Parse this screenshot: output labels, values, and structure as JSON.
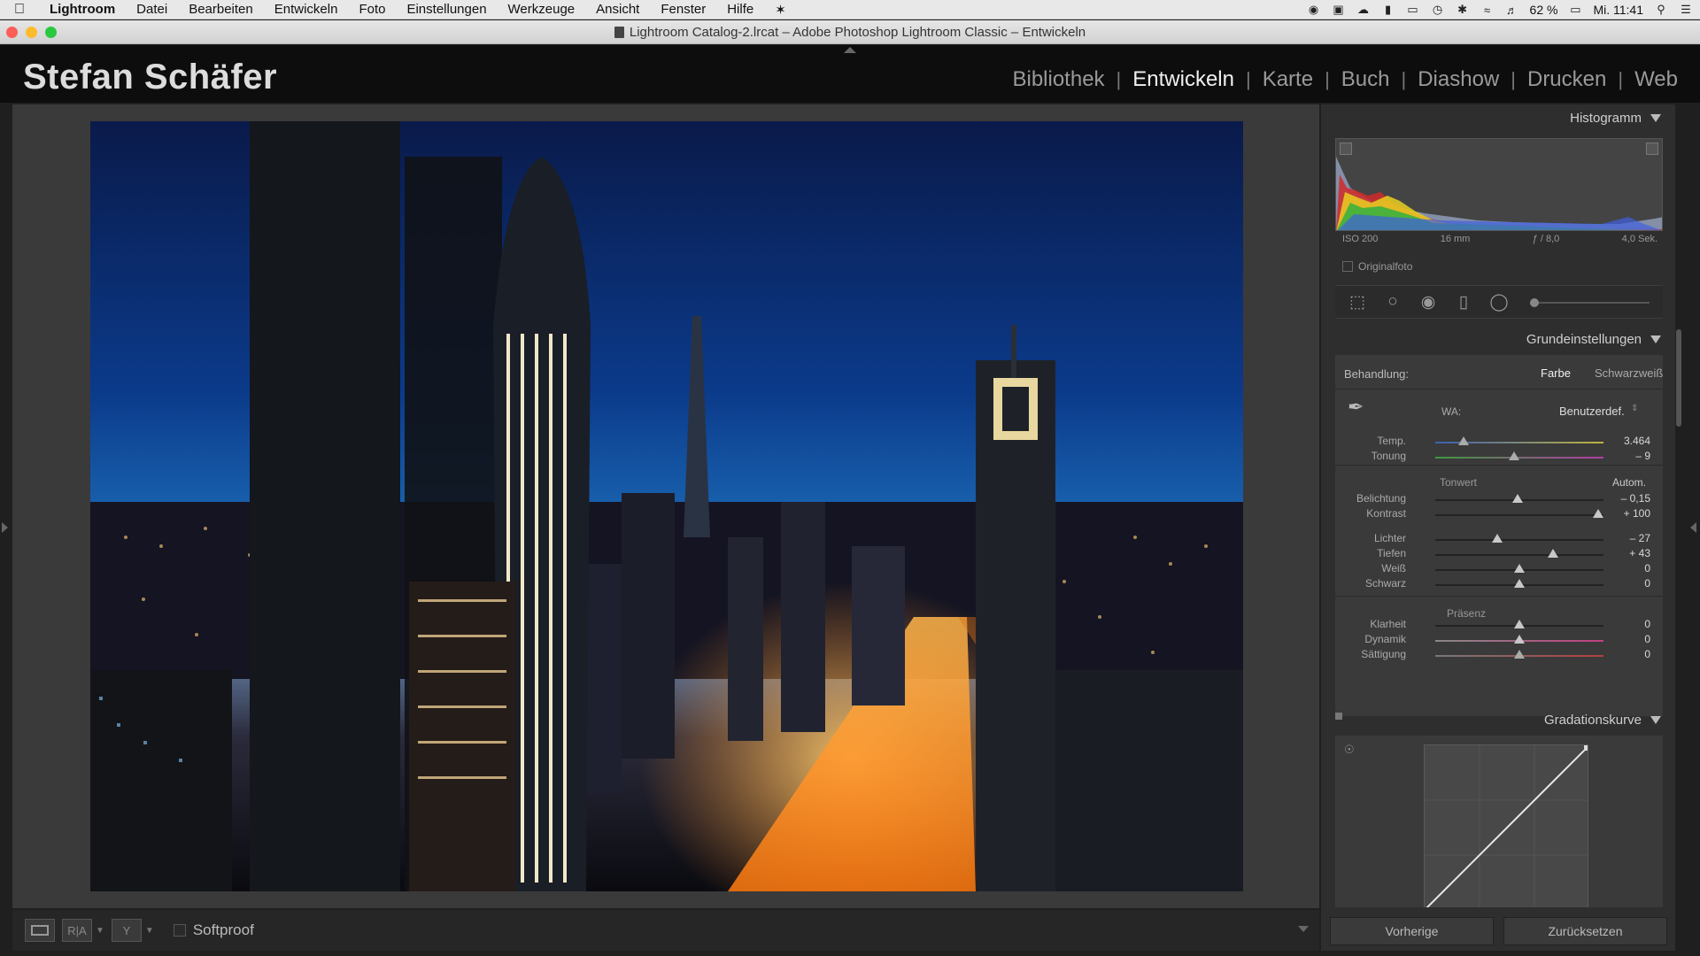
{
  "menubar": {
    "app": "Lightroom",
    "items": [
      "Datei",
      "Bearbeiten",
      "Entwickeln",
      "Foto",
      "Einstellungen",
      "Werkzeuge",
      "Ansicht",
      "Fenster",
      "Hilfe"
    ],
    "battery": "62 %",
    "clock": "Mi. 11:41"
  },
  "window": {
    "title": "Lightroom Catalog-2.lrcat – Adobe Photoshop Lightroom Classic – Entwickeln"
  },
  "identity": {
    "plate": "Stefan Schäfer",
    "modules": [
      "Bibliothek",
      "Entwickeln",
      "Karte",
      "Buch",
      "Diashow",
      "Drucken",
      "Web"
    ],
    "active_module": "Entwickeln"
  },
  "toolbar": {
    "softproof_label": "Softproof",
    "compare_label": "R|A",
    "survey_label": "Y"
  },
  "histogram": {
    "title": "Histogramm",
    "iso": "ISO 200",
    "focal": "16 mm",
    "aperture": "ƒ / 8,0",
    "shutter": "4,0 Sek.",
    "original_label": "Originalfoto"
  },
  "basic": {
    "title": "Grundeinstellungen",
    "treatment_label": "Behandlung:",
    "treatment_color": "Farbe",
    "treatment_bw": "Schwarzweiß",
    "wb_label": "WA:",
    "wb_value": "Benutzerdef.",
    "tone_label": "Tonwert",
    "auto_label": "Autom.",
    "presence_label": "Präsenz",
    "sliders": [
      {
        "label": "Temp.",
        "value": "3.464",
        "pos": 0.17
      },
      {
        "label": "Tonung",
        "value": "– 9",
        "pos": 0.47
      },
      {
        "label": "Belichtung",
        "value": "– 0,15",
        "pos": 0.49
      },
      {
        "label": "Kontrast",
        "value": "+ 100",
        "pos": 0.97
      },
      {
        "label": "Lichter",
        "value": "– 27",
        "pos": 0.37
      },
      {
        "label": "Tiefen",
        "value": "+ 43",
        "pos": 0.7
      },
      {
        "label": "Weiß",
        "value": "0",
        "pos": 0.5
      },
      {
        "label": "Schwarz",
        "value": "0",
        "pos": 0.5
      },
      {
        "label": "Klarheit",
        "value": "0",
        "pos": 0.5
      },
      {
        "label": "Dynamik",
        "value": "0",
        "pos": 0.5
      },
      {
        "label": "Sättigung",
        "value": "0",
        "pos": 0.5
      }
    ]
  },
  "curve": {
    "title": "Gradationskurve"
  },
  "buttons": {
    "previous": "Vorherige",
    "reset": "Zurücksetzen"
  }
}
